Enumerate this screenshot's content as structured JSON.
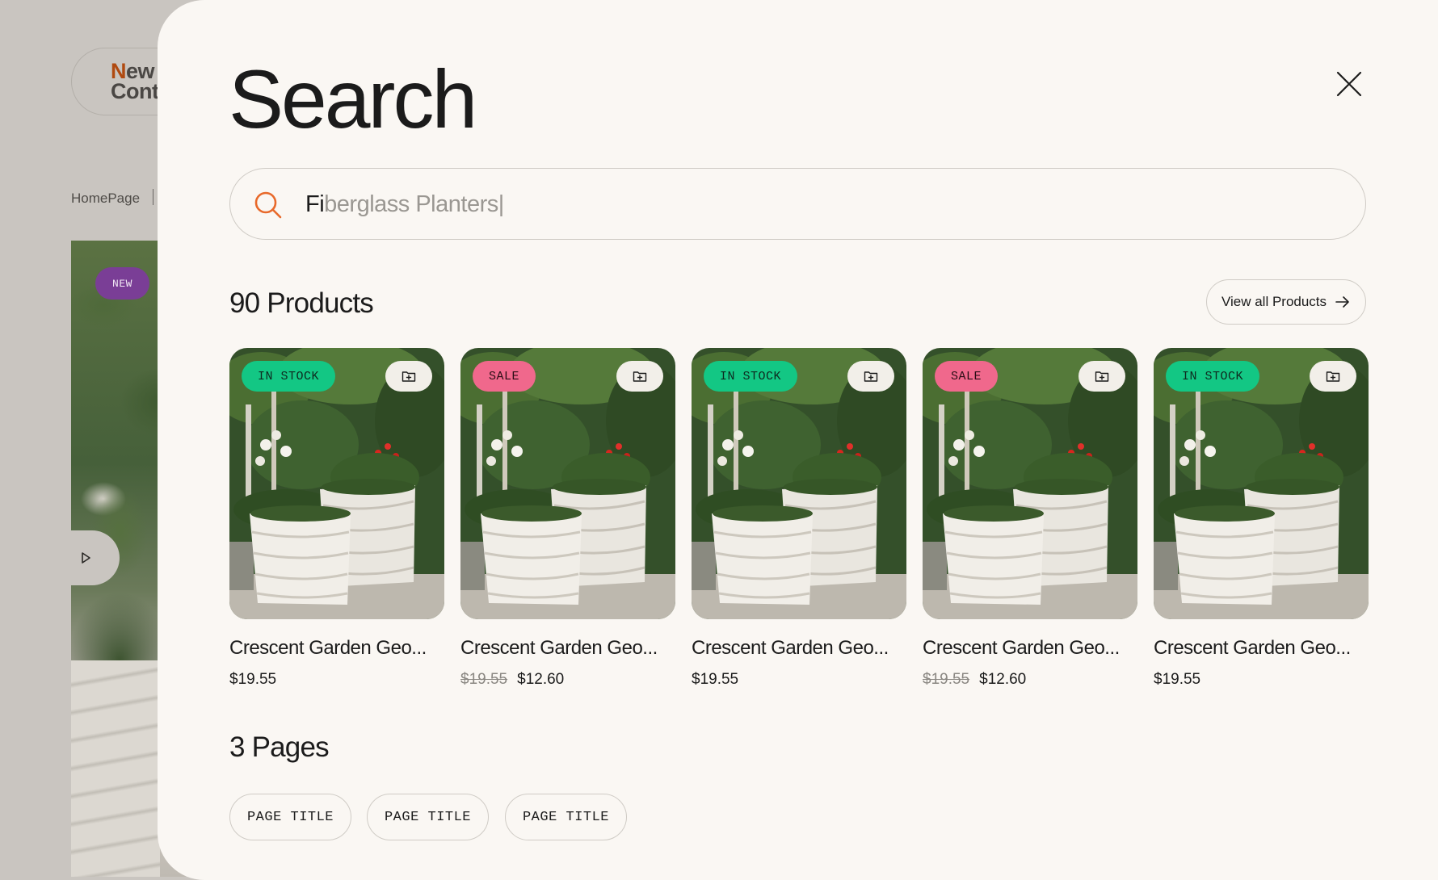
{
  "background": {
    "logo_line1": "New",
    "logo_line2": "Cont",
    "breadcrumb": "HomePage",
    "hero_badge": "NEW"
  },
  "search": {
    "title": "Search",
    "query_typed": "Fi",
    "query_suggestion": "berglass Planters|"
  },
  "results": {
    "products_count": "90 Products",
    "view_all_label": "View all Products",
    "products": [
      {
        "badge": "IN STOCK",
        "badge_type": "stock",
        "name": "Crescent Garden Geo...",
        "price": "$19.55",
        "old_price": ""
      },
      {
        "badge": "SALE",
        "badge_type": "sale",
        "name": "Crescent Garden Geo...",
        "price": "$12.60",
        "old_price": "$19.55"
      },
      {
        "badge": "IN STOCK",
        "badge_type": "stock",
        "name": "Crescent Garden Geo...",
        "price": "$19.55",
        "old_price": ""
      },
      {
        "badge": "SALE",
        "badge_type": "sale",
        "name": "Crescent Garden Geo...",
        "price": "$12.60",
        "old_price": "$19.55"
      },
      {
        "badge": "IN STOCK",
        "badge_type": "stock",
        "name": "Crescent Garden Geo...",
        "price": "$19.55",
        "old_price": ""
      }
    ],
    "pages_count": "3 Pages",
    "pages": [
      "PAGE TITLE",
      "PAGE TITLE",
      "PAGE TITLE"
    ]
  },
  "colors": {
    "accent": "#e8692a",
    "in_stock": "#13c784",
    "sale": "#f0688c",
    "modal_bg": "#faf7f3"
  },
  "icons": {
    "search": "search-icon",
    "close": "close-icon",
    "arrow": "arrow-right-icon",
    "save": "folder-plus-icon",
    "play": "play-icon"
  }
}
